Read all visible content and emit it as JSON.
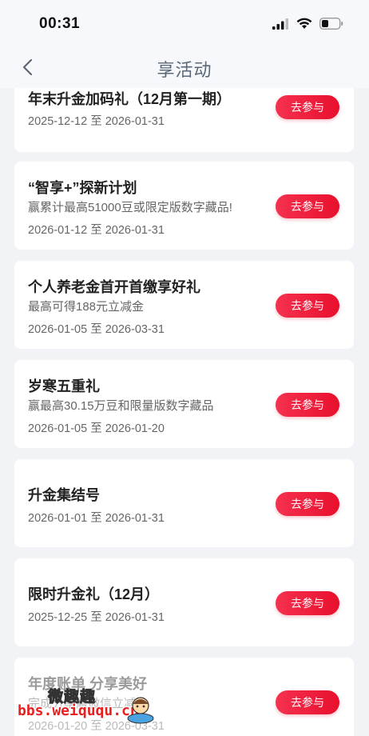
{
  "status_bar": {
    "time": "00:31"
  },
  "nav": {
    "title": "享活动",
    "back_icon": "chevron-left-icon"
  },
  "activities": [
    {
      "title": "年末升金加码礼（12月第一期）",
      "subtitle": "",
      "date": "2025-12-12 至 2026-01-31",
      "button": "去参与"
    },
    {
      "title": "“智享+”探新计划",
      "subtitle": "赢累计最高51000豆或限定版数字藏品!",
      "date": "2026-01-12 至 2026-01-31",
      "button": "去参与"
    },
    {
      "title": "个人养老金首开首缴享好礼",
      "subtitle": "最高可得188元立减金",
      "date": "2026-01-05 至 2026-03-31",
      "button": "去参与"
    },
    {
      "title": "岁寒五重礼",
      "subtitle": "赢最高30.15万豆和限量版数字藏品",
      "date": "2026-01-05 至 2026-01-20",
      "button": "去参与"
    },
    {
      "title": "升金集结号",
      "subtitle": "",
      "date": "2026-01-01 至 2026-01-31",
      "button": "去参与"
    },
    {
      "title": "限时升金礼（12月）",
      "subtitle": "",
      "date": "2025-12-25 至 2026-01-31",
      "button": "去参与"
    },
    {
      "title": "年度账单 分享美好",
      "subtitle": "完成分享赢微信立减金",
      "date": "2026-01-20 至 2026-03-31",
      "button": "去参与"
    }
  ],
  "watermark": {
    "text_cn": "微趣趣",
    "url": "bbs.weiququ.cn"
  },
  "colors": {
    "accent": "#e8102d",
    "background": "#f2f3f7",
    "title": "#5b6775"
  }
}
